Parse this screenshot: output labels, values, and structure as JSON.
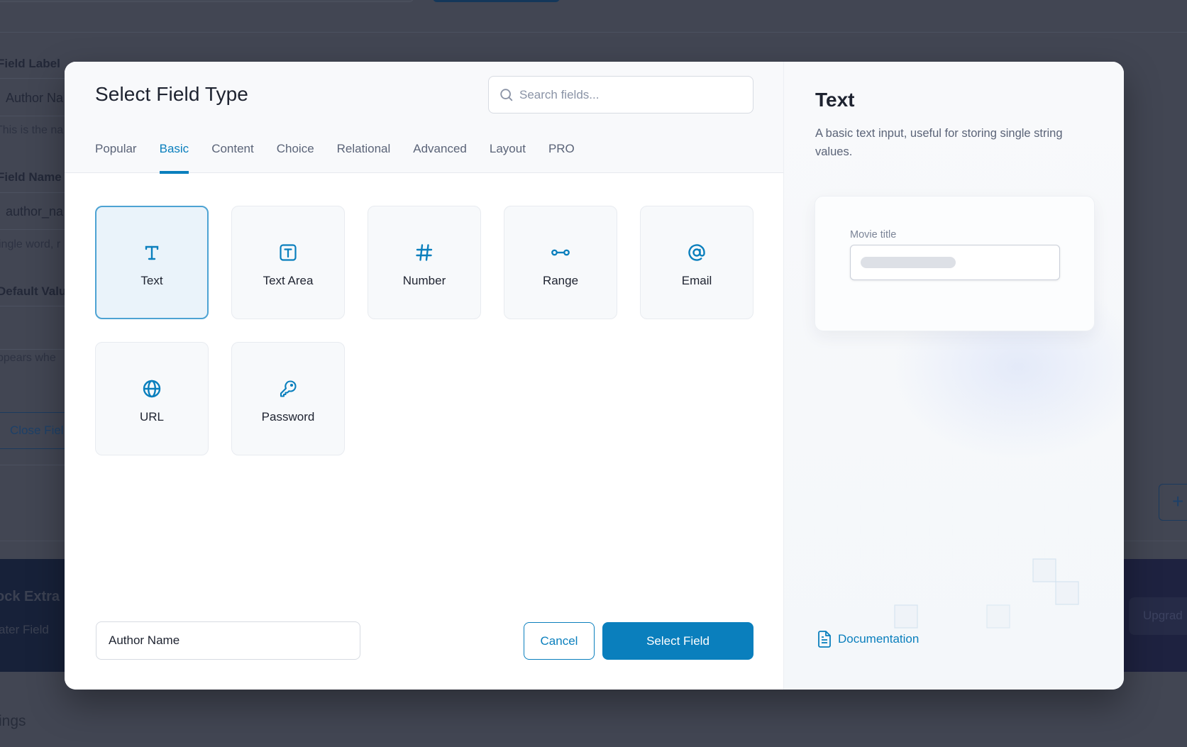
{
  "background": {
    "field_label_heading": "Field Label",
    "field_label_value": "Author Na",
    "field_label_help": "This is the na",
    "field_name_heading": "Field Name",
    "field_name_value": "author_na",
    "field_name_help": "ingle word, r",
    "default_value_heading": "Default Valu",
    "default_value_help": "ppears whe",
    "close_field_button": "Close Fiel",
    "band_title": "ock Extra I",
    "band_subtitle": "ater Field",
    "upgrade_button": "Upgrad",
    "plus_button": "+",
    "settings_heading": "ings"
  },
  "modal": {
    "title": "Select Field Type",
    "search": {
      "placeholder": "Search fields...",
      "value": ""
    },
    "tabs": [
      {
        "label": "Popular",
        "active": false
      },
      {
        "label": "Basic",
        "active": true
      },
      {
        "label": "Content",
        "active": false
      },
      {
        "label": "Choice",
        "active": false
      },
      {
        "label": "Relational",
        "active": false
      },
      {
        "label": "Advanced",
        "active": false
      },
      {
        "label": "Layout",
        "active": false
      },
      {
        "label": "PRO",
        "active": false
      }
    ],
    "field_types": [
      {
        "label": "Text",
        "icon": "text-icon",
        "selected": true
      },
      {
        "label": "Text Area",
        "icon": "textarea-icon",
        "selected": false
      },
      {
        "label": "Number",
        "icon": "hash-icon",
        "selected": false
      },
      {
        "label": "Range",
        "icon": "range-icon",
        "selected": false
      },
      {
        "label": "Email",
        "icon": "at-sign-icon",
        "selected": false
      },
      {
        "label": "URL",
        "icon": "globe-icon",
        "selected": false
      },
      {
        "label": "Password",
        "icon": "key-icon",
        "selected": false
      }
    ],
    "field_label_input": {
      "value": "Author Name"
    },
    "cancel_label": "Cancel",
    "select_label": "Select Field",
    "preview": {
      "title": "Text",
      "description": "A basic text input, useful for storing single string values.",
      "example_label": "Movie title",
      "documentation_label": "Documentation"
    },
    "colors": {
      "accent": "#0a7fbd",
      "selected_card_bg": "#eaf3fa",
      "selected_card_border": "#4da3d3"
    }
  }
}
